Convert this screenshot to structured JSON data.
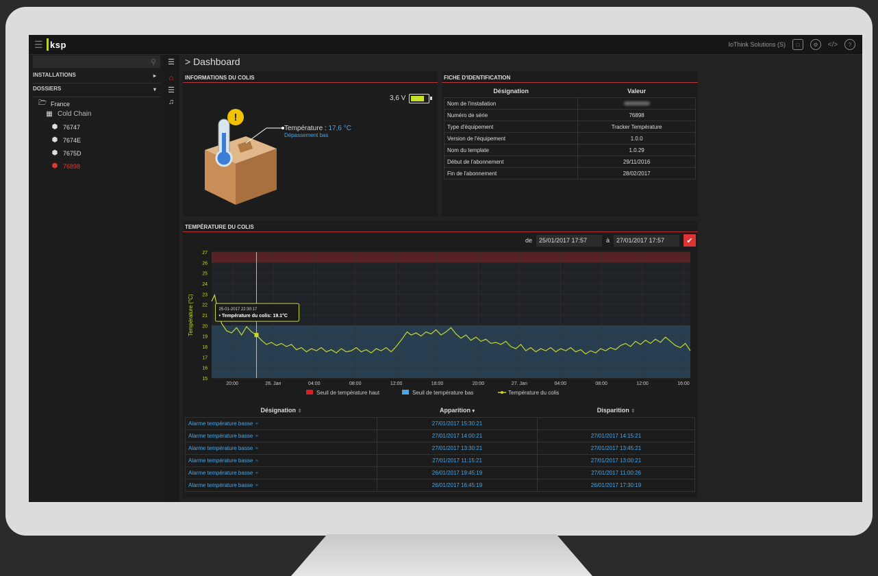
{
  "app": {
    "logo": "ksp",
    "company": "IoThink Solutions (S)"
  },
  "breadcrumb": "> Dashboard",
  "sidebar": {
    "search_placeholder": "",
    "sections": [
      "INSTALLATIONS",
      "DOSSIERS"
    ],
    "folder": "France",
    "group": "Cold Chain",
    "devices": [
      "76747",
      "7674E",
      "7675D",
      "76898"
    ],
    "active_device": "76898"
  },
  "info_panel": {
    "title": "INFORMATIONS DU COLIS",
    "battery": "3,6 V",
    "battery_level": 0.85,
    "temp_label": "Température : ",
    "temp_value": "17,6 °C",
    "temp_status": "Dépassement bas"
  },
  "id_panel": {
    "title": "FICHE D'IDENTIFICATION",
    "headers": [
      "Désignation",
      "Valeur"
    ],
    "rows": [
      {
        "label": "Nom de l'installation",
        "value": ""
      },
      {
        "label": "Numéro de série",
        "value": "76898"
      },
      {
        "label": "Type d'équipement",
        "value": "Tracker Température"
      },
      {
        "label": "Version de l'équipement",
        "value": "1.0.0"
      },
      {
        "label": "Nom du template",
        "value": "1.0.29"
      },
      {
        "label": "Début de l'abonnement",
        "value": "29/11/2016"
      },
      {
        "label": "Fin de l'abonnement",
        "value": "28/02/2017"
      }
    ]
  },
  "chart_panel": {
    "title": "TEMPÉRATURE DU COLIS",
    "from_label": "de",
    "from_value": "25/01/2017 17:57",
    "to_label": "à",
    "to_value": "27/01/2017 17:57"
  },
  "chart_data": {
    "type": "line",
    "ylabel": "Température (°C)",
    "ylim": [
      15,
      27
    ],
    "yticks": [
      15,
      16,
      17,
      18,
      19,
      20,
      21,
      22,
      23,
      24,
      25,
      26,
      27
    ],
    "xticks": [
      "20:00",
      "26. Jan",
      "04:00",
      "08:00",
      "12:00",
      "16:00",
      "20:00",
      "27. Jan",
      "04:00",
      "08:00",
      "12:00",
      "16:00"
    ],
    "x_range_hours": [
      0,
      48
    ],
    "high_threshold": 26,
    "low_threshold": 20,
    "legend": [
      "Seuil de température haut",
      "Seuil de température bas",
      "Température du colis"
    ],
    "colors": {
      "high": "#d62020",
      "low": "#4aa6e6",
      "series": "#c8d92a"
    },
    "tooltip": {
      "time": "25-01-2017 22:30:17",
      "text": "• Température du colis: 19.1°C",
      "x_hours": 4.5,
      "value": 19.1
    },
    "series": [
      {
        "name": "Température du colis",
        "points": [
          [
            0,
            22.3
          ],
          [
            0.3,
            22.9
          ],
          [
            0.6,
            21.6
          ],
          [
            1,
            20.2
          ],
          [
            1.5,
            19.5
          ],
          [
            2,
            19.3
          ],
          [
            2.5,
            19.8
          ],
          [
            3,
            19.1
          ],
          [
            3.5,
            19.9
          ],
          [
            4,
            19.4
          ],
          [
            4.5,
            19.1
          ],
          [
            5,
            18.6
          ],
          [
            5.5,
            18.2
          ],
          [
            6,
            18.4
          ],
          [
            6.5,
            18.1
          ],
          [
            7,
            18.3
          ],
          [
            7.5,
            18.0
          ],
          [
            8,
            18.2
          ],
          [
            8.5,
            17.7
          ],
          [
            9,
            17.9
          ],
          [
            9.5,
            17.5
          ],
          [
            10,
            17.8
          ],
          [
            10.5,
            17.6
          ],
          [
            11,
            17.9
          ],
          [
            11.5,
            17.5
          ],
          [
            12,
            17.7
          ],
          [
            12.5,
            17.4
          ],
          [
            13,
            17.8
          ],
          [
            13.5,
            17.5
          ],
          [
            14,
            17.6
          ],
          [
            14.5,
            17.9
          ],
          [
            15,
            17.5
          ],
          [
            15.5,
            17.7
          ],
          [
            16,
            17.4
          ],
          [
            16.5,
            17.8
          ],
          [
            17,
            17.6
          ],
          [
            17.5,
            17.9
          ],
          [
            18,
            17.5
          ],
          [
            18.5,
            18.0
          ],
          [
            19,
            18.6
          ],
          [
            19.3,
            19.0
          ],
          [
            19.6,
            19.4
          ],
          [
            20,
            19.1
          ],
          [
            20.5,
            19.3
          ],
          [
            21,
            19.0
          ],
          [
            21.5,
            19.4
          ],
          [
            22,
            19.2
          ],
          [
            22.5,
            19.6
          ],
          [
            23,
            19.1
          ],
          [
            23.5,
            19.4
          ],
          [
            24,
            19.8
          ],
          [
            24.5,
            19.2
          ],
          [
            25,
            18.8
          ],
          [
            25.5,
            19.1
          ],
          [
            26,
            18.6
          ],
          [
            26.5,
            18.9
          ],
          [
            27,
            18.5
          ],
          [
            27.5,
            18.7
          ],
          [
            28,
            18.3
          ],
          [
            28.5,
            18.4
          ],
          [
            29,
            18.2
          ],
          [
            29.5,
            18.5
          ],
          [
            30,
            18.0
          ],
          [
            30.5,
            17.8
          ],
          [
            31,
            18.2
          ],
          [
            31.5,
            17.6
          ],
          [
            32,
            17.9
          ],
          [
            32.5,
            17.5
          ],
          [
            33,
            17.8
          ],
          [
            33.5,
            17.6
          ],
          [
            34,
            17.9
          ],
          [
            34.5,
            17.5
          ],
          [
            35,
            17.8
          ],
          [
            35.5,
            17.6
          ],
          [
            36,
            17.9
          ],
          [
            36.5,
            17.5
          ],
          [
            37,
            17.7
          ],
          [
            37.5,
            17.3
          ],
          [
            38,
            17.6
          ],
          [
            38.5,
            17.4
          ],
          [
            39,
            17.8
          ],
          [
            39.5,
            17.6
          ],
          [
            40,
            17.9
          ],
          [
            40.5,
            17.7
          ],
          [
            41,
            18.1
          ],
          [
            41.5,
            18.3
          ],
          [
            42,
            18.0
          ],
          [
            42.5,
            18.5
          ],
          [
            43,
            18.2
          ],
          [
            43.5,
            18.6
          ],
          [
            44,
            18.3
          ],
          [
            44.5,
            18.7
          ],
          [
            45,
            18.4
          ],
          [
            45.5,
            18.9
          ],
          [
            46,
            18.5
          ],
          [
            46.5,
            18.1
          ],
          [
            47,
            17.9
          ],
          [
            47.5,
            18.3
          ],
          [
            48,
            17.6
          ]
        ]
      }
    ]
  },
  "alarms": {
    "headers": [
      "Désignation",
      "Apparition",
      "Disparition"
    ],
    "rows": [
      {
        "designation": "Alarme température basse",
        "apparition": "27/01/2017 15:30:21",
        "disparition": ""
      },
      {
        "designation": "Alarme température basse",
        "apparition": "27/01/2017 14:00:21",
        "disparition": "27/01/2017 14:15:21"
      },
      {
        "designation": "Alarme température basse",
        "apparition": "27/01/2017 13:30:21",
        "disparition": "27/01/2017 13:45:21"
      },
      {
        "designation": "Alarme température basse",
        "apparition": "27/01/2017 11:15:21",
        "disparition": "27/01/2017 13:00:21"
      },
      {
        "designation": "Alarme température basse",
        "apparition": "26/01/2017 19:45:19",
        "disparition": "27/01/2017 11:00:26"
      },
      {
        "designation": "Alarme température basse",
        "apparition": "26/01/2017 16:45:19",
        "disparition": "26/01/2017 17:30:19"
      }
    ]
  }
}
